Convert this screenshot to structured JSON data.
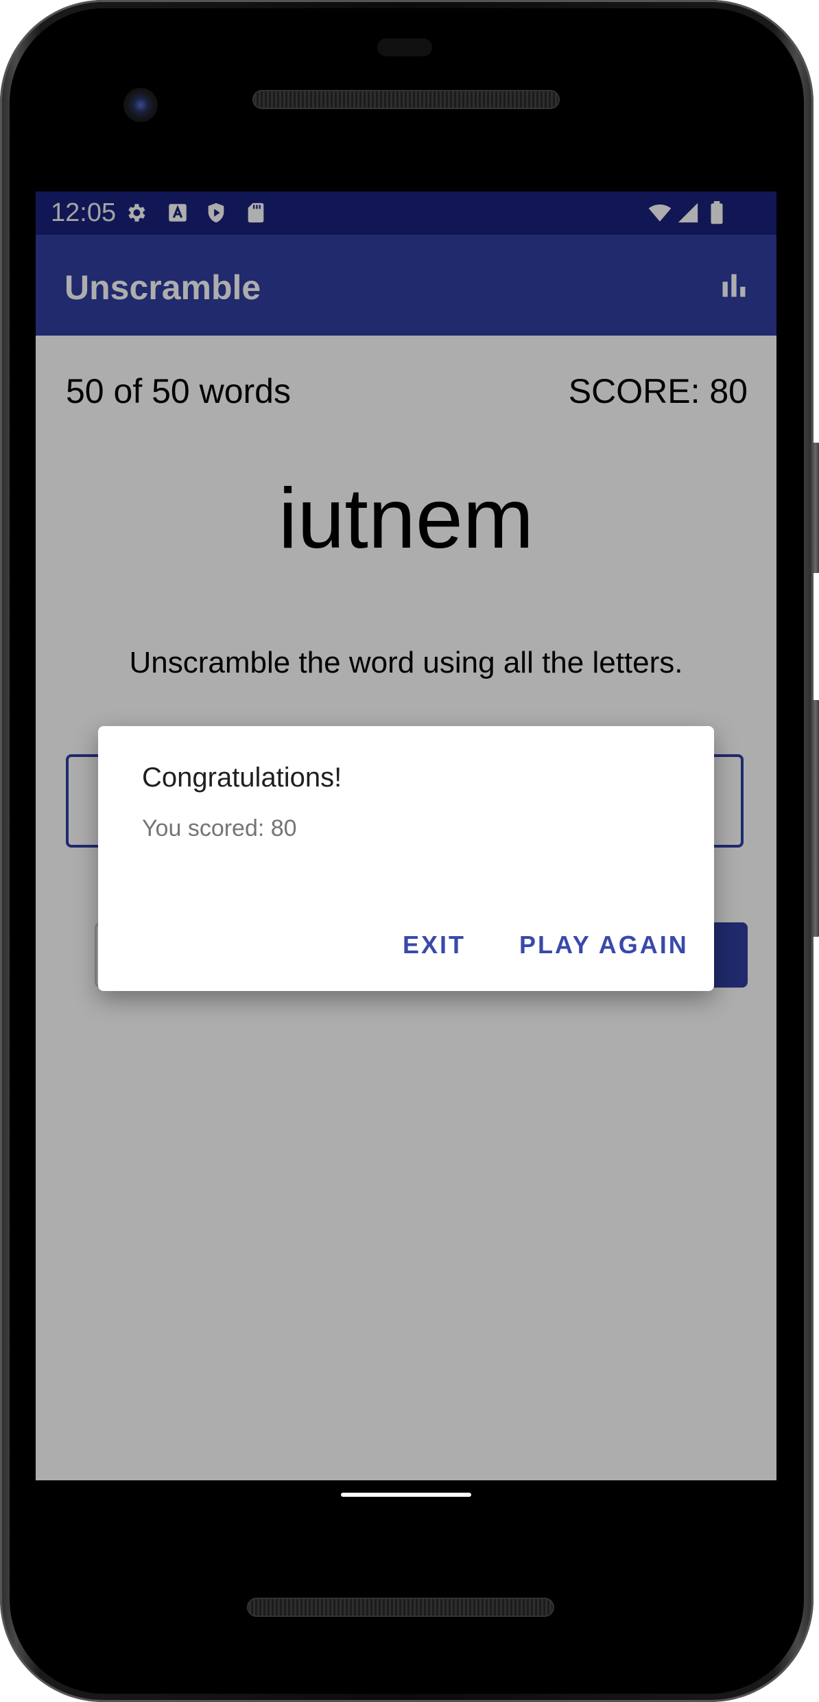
{
  "status_bar": {
    "time": "12:05",
    "left_icons": [
      "gear-icon",
      "keyboard-a-icon",
      "shield-play-icon",
      "sd-card-icon"
    ],
    "right_icons": [
      "wifi-icon",
      "cell-signal-icon",
      "battery-icon"
    ]
  },
  "app_bar": {
    "title": "Unscramble",
    "action_icon": "bar-chart-icon"
  },
  "game": {
    "word_count": "50 of 50 words",
    "score": "SCORE: 80",
    "scrambled_word": "iutnem",
    "instructions": "Unscramble the word using all the letters."
  },
  "dialog": {
    "title": "Congratulations!",
    "message": "You scored: 80",
    "exit_label": "EXIT",
    "play_again_label": "PLAY AGAIN"
  },
  "colors": {
    "status_bar": "#1a237e",
    "app_bar": "#303f9f",
    "accent": "#3949ab",
    "scrim": "rgba(0,0,0,0.32)"
  }
}
